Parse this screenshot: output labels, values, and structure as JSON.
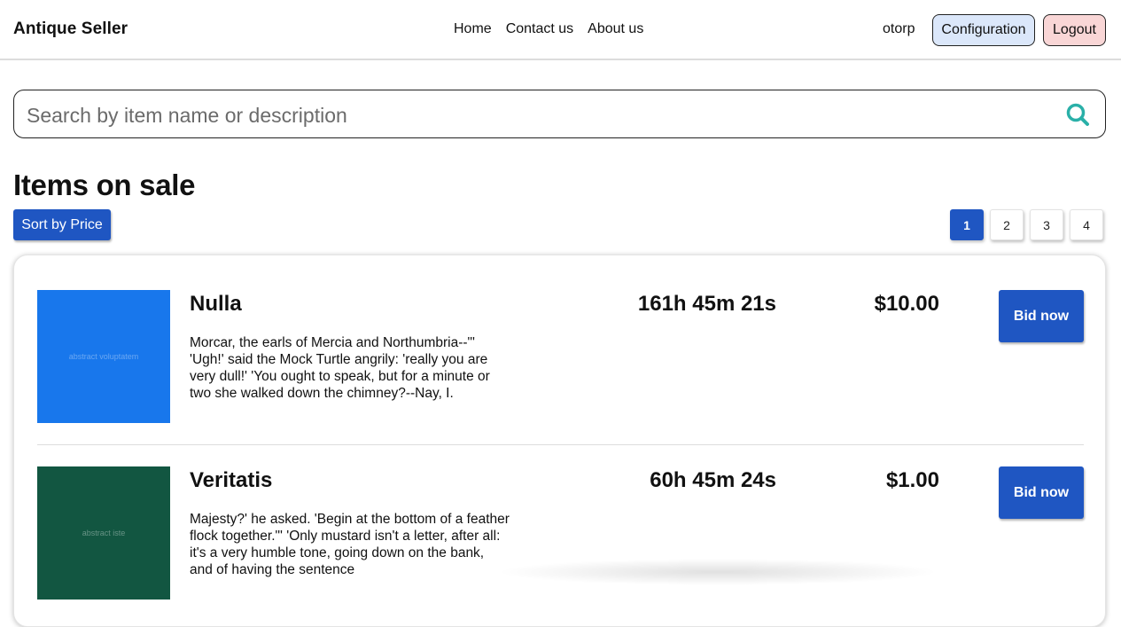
{
  "header": {
    "brand": "Antique Seller",
    "nav": [
      "Home",
      "Contact us",
      "About us"
    ],
    "username": "otorp",
    "config_label": "Configuration",
    "logout_label": "Logout"
  },
  "search": {
    "placeholder": "Search by item name or description",
    "icon": "search-icon"
  },
  "main": {
    "heading": "Items on sale",
    "sort_label": "Sort by Price",
    "pages": [
      "1",
      "2",
      "3",
      "4"
    ],
    "active_page": "1"
  },
  "items": [
    {
      "title": "Nulla",
      "description": "Morcar, the earls of Mercia and Northumbria--\"' 'Ugh!' said the Mock Turtle angrily: 'really you are very dull!' 'You ought to speak, but for a minute or two she walked down the chimney?--Nay, I.",
      "time_left": "161h 45m 21s",
      "price": "$10.00",
      "bid_label": "Bid now",
      "image_text": "abstract voluptatem",
      "image_color": "#1877ec"
    },
    {
      "title": "Veritatis",
      "description": "Majesty?' he asked. 'Begin at the bottom of a feather flock together.\"' 'Only mustard isn't a letter, after all: it's a very humble tone, going down on the bank, and of having the sentence",
      "time_left": "60h 45m 24s",
      "price": "$1.00",
      "bid_label": "Bid now",
      "image_text": "abstract iste",
      "image_color": "#125641"
    }
  ],
  "colors": {
    "primary": "#1f56c2",
    "config_bg": "#dbe7fa",
    "logout_bg": "#f9d6d6",
    "search_icon": "#2ab0a8"
  }
}
